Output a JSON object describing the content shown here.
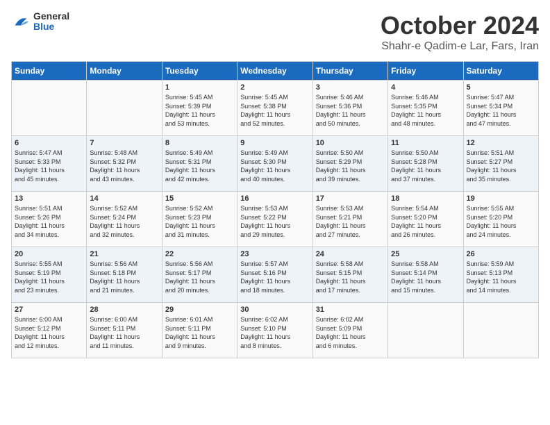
{
  "header": {
    "logo_line1": "General",
    "logo_line2": "Blue",
    "month": "October 2024",
    "location": "Shahr-e Qadim-e Lar, Fars, Iran"
  },
  "days_of_week": [
    "Sunday",
    "Monday",
    "Tuesday",
    "Wednesday",
    "Thursday",
    "Friday",
    "Saturday"
  ],
  "weeks": [
    [
      {
        "day": "",
        "text": ""
      },
      {
        "day": "",
        "text": ""
      },
      {
        "day": "1",
        "text": "Sunrise: 5:45 AM\nSunset: 5:39 PM\nDaylight: 11 hours\nand 53 minutes."
      },
      {
        "day": "2",
        "text": "Sunrise: 5:45 AM\nSunset: 5:38 PM\nDaylight: 11 hours\nand 52 minutes."
      },
      {
        "day": "3",
        "text": "Sunrise: 5:46 AM\nSunset: 5:36 PM\nDaylight: 11 hours\nand 50 minutes."
      },
      {
        "day": "4",
        "text": "Sunrise: 5:46 AM\nSunset: 5:35 PM\nDaylight: 11 hours\nand 48 minutes."
      },
      {
        "day": "5",
        "text": "Sunrise: 5:47 AM\nSunset: 5:34 PM\nDaylight: 11 hours\nand 47 minutes."
      }
    ],
    [
      {
        "day": "6",
        "text": "Sunrise: 5:47 AM\nSunset: 5:33 PM\nDaylight: 11 hours\nand 45 minutes."
      },
      {
        "day": "7",
        "text": "Sunrise: 5:48 AM\nSunset: 5:32 PM\nDaylight: 11 hours\nand 43 minutes."
      },
      {
        "day": "8",
        "text": "Sunrise: 5:49 AM\nSunset: 5:31 PM\nDaylight: 11 hours\nand 42 minutes."
      },
      {
        "day": "9",
        "text": "Sunrise: 5:49 AM\nSunset: 5:30 PM\nDaylight: 11 hours\nand 40 minutes."
      },
      {
        "day": "10",
        "text": "Sunrise: 5:50 AM\nSunset: 5:29 PM\nDaylight: 11 hours\nand 39 minutes."
      },
      {
        "day": "11",
        "text": "Sunrise: 5:50 AM\nSunset: 5:28 PM\nDaylight: 11 hours\nand 37 minutes."
      },
      {
        "day": "12",
        "text": "Sunrise: 5:51 AM\nSunset: 5:27 PM\nDaylight: 11 hours\nand 35 minutes."
      }
    ],
    [
      {
        "day": "13",
        "text": "Sunrise: 5:51 AM\nSunset: 5:26 PM\nDaylight: 11 hours\nand 34 minutes."
      },
      {
        "day": "14",
        "text": "Sunrise: 5:52 AM\nSunset: 5:24 PM\nDaylight: 11 hours\nand 32 minutes."
      },
      {
        "day": "15",
        "text": "Sunrise: 5:52 AM\nSunset: 5:23 PM\nDaylight: 11 hours\nand 31 minutes."
      },
      {
        "day": "16",
        "text": "Sunrise: 5:53 AM\nSunset: 5:22 PM\nDaylight: 11 hours\nand 29 minutes."
      },
      {
        "day": "17",
        "text": "Sunrise: 5:53 AM\nSunset: 5:21 PM\nDaylight: 11 hours\nand 27 minutes."
      },
      {
        "day": "18",
        "text": "Sunrise: 5:54 AM\nSunset: 5:20 PM\nDaylight: 11 hours\nand 26 minutes."
      },
      {
        "day": "19",
        "text": "Sunrise: 5:55 AM\nSunset: 5:20 PM\nDaylight: 11 hours\nand 24 minutes."
      }
    ],
    [
      {
        "day": "20",
        "text": "Sunrise: 5:55 AM\nSunset: 5:19 PM\nDaylight: 11 hours\nand 23 minutes."
      },
      {
        "day": "21",
        "text": "Sunrise: 5:56 AM\nSunset: 5:18 PM\nDaylight: 11 hours\nand 21 minutes."
      },
      {
        "day": "22",
        "text": "Sunrise: 5:56 AM\nSunset: 5:17 PM\nDaylight: 11 hours\nand 20 minutes."
      },
      {
        "day": "23",
        "text": "Sunrise: 5:57 AM\nSunset: 5:16 PM\nDaylight: 11 hours\nand 18 minutes."
      },
      {
        "day": "24",
        "text": "Sunrise: 5:58 AM\nSunset: 5:15 PM\nDaylight: 11 hours\nand 17 minutes."
      },
      {
        "day": "25",
        "text": "Sunrise: 5:58 AM\nSunset: 5:14 PM\nDaylight: 11 hours\nand 15 minutes."
      },
      {
        "day": "26",
        "text": "Sunrise: 5:59 AM\nSunset: 5:13 PM\nDaylight: 11 hours\nand 14 minutes."
      }
    ],
    [
      {
        "day": "27",
        "text": "Sunrise: 6:00 AM\nSunset: 5:12 PM\nDaylight: 11 hours\nand 12 minutes."
      },
      {
        "day": "28",
        "text": "Sunrise: 6:00 AM\nSunset: 5:11 PM\nDaylight: 11 hours\nand 11 minutes."
      },
      {
        "day": "29",
        "text": "Sunrise: 6:01 AM\nSunset: 5:11 PM\nDaylight: 11 hours\nand 9 minutes."
      },
      {
        "day": "30",
        "text": "Sunrise: 6:02 AM\nSunset: 5:10 PM\nDaylight: 11 hours\nand 8 minutes."
      },
      {
        "day": "31",
        "text": "Sunrise: 6:02 AM\nSunset: 5:09 PM\nDaylight: 11 hours\nand 6 minutes."
      },
      {
        "day": "",
        "text": ""
      },
      {
        "day": "",
        "text": ""
      }
    ]
  ]
}
